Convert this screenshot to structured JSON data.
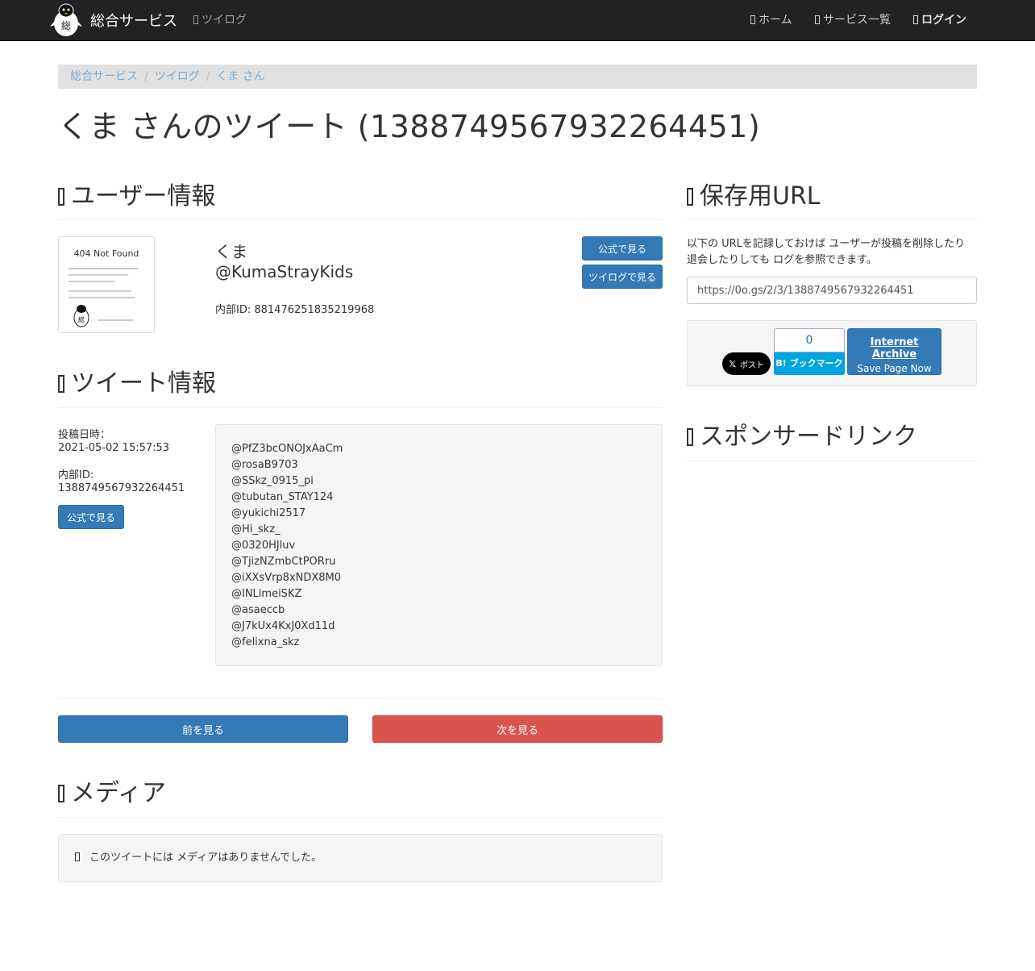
{
  "navbar": {
    "brand": "総合サービス",
    "twilog_link": "ツイログ",
    "home": "ホーム",
    "services": "サービス一覧",
    "login": "ログイン"
  },
  "breadcrumb": [
    "総合サービス",
    "ツイログ",
    "くま さん"
  ],
  "page_title": "くま さんのツイート (1388749567932264451)",
  "user_section": {
    "heading": "ユーザー情報",
    "thumbnail_title": "404 Not Found",
    "name": "くま",
    "handle": "@KumaStrayKids",
    "internal_id": "内部ID: 881476251835219968",
    "btn_official": "公式で見る",
    "btn_twilog": "ツイログで見る"
  },
  "tweet_section": {
    "heading": "ツイート情報",
    "posted_label": "投稿日時：",
    "posted_value": "2021-05-02 15:57:53",
    "internal_label": "内部ID:",
    "internal_value": "1388749567932264451",
    "btn_official": "公式で見る",
    "lines": [
      "@PfZ3bcONOJxAaCm",
      "@rosaB9703",
      "@SSkz_0915_pi",
      "@tubutan_STAY124",
      "@yukichi2517",
      "@Hi_skz_",
      "@0320HJluv",
      "@TjizNZmbCtPORru",
      "@iXXsVrp8xNDX8M0",
      "@INLimeiSKZ",
      "@asaeccb",
      "@J7kUx4KxJ0Xd11d",
      "@felixna_skz"
    ]
  },
  "pager": {
    "prev": "前を見る",
    "next": "次を見る"
  },
  "media_section": {
    "heading": "メディア",
    "empty_message": "このツイートには メディアはありませんでした。"
  },
  "save_section": {
    "heading": "保存用URL",
    "description": "以下の URLを記録しておけば ユーザーが投稿を削除したり 退会したりしても ログを参照できます。",
    "url": "https://0o.gs/2/3/1388749567932264451",
    "x_button": "ポスト",
    "hatena_count": "0",
    "hatena_button": "B! ブックマーク",
    "ia_title": "Internet Archive",
    "ia_sub": "Save Page Now"
  },
  "sponsor_section": {
    "heading": "スポンサードリンク"
  },
  "colors": {
    "primary": "#337ab7",
    "danger": "#d9534f",
    "navbar": "#222222",
    "hatena": "#00a4de"
  }
}
